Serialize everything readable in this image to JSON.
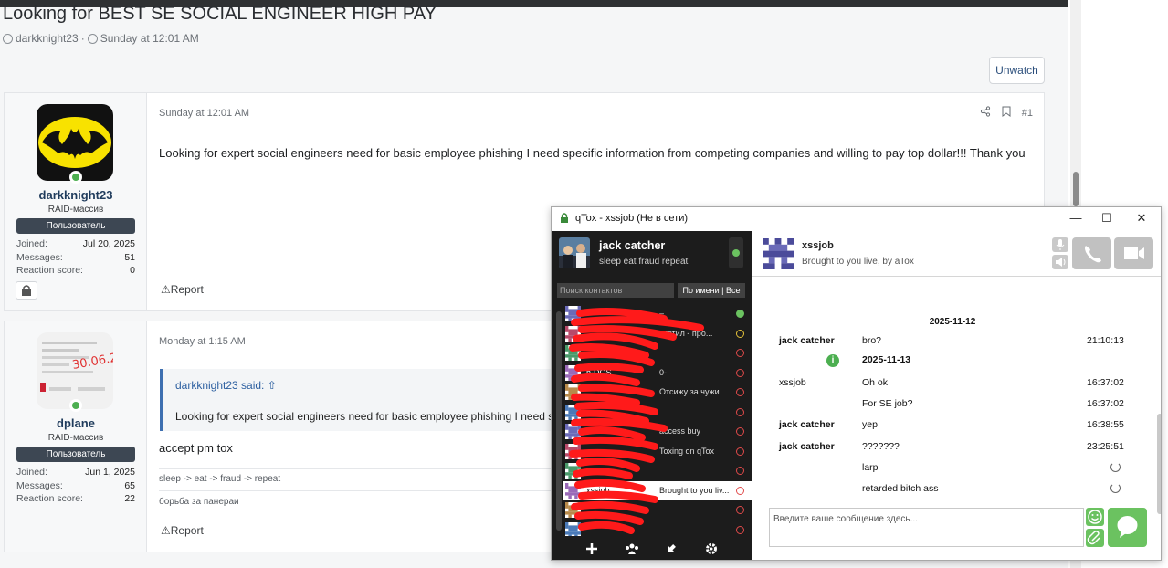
{
  "forum": {
    "thread_title": "Looking for BEST SE SOCIAL ENGINEER HIGH PAY",
    "thread_author": "darkknight23",
    "thread_date": "Sunday at 12:01 AM",
    "unwatch_label": "Unwatch",
    "posts": [
      {
        "username": "darkknight23",
        "user_title": "RAID-массив",
        "banner": "Пользователь",
        "stats": [
          {
            "label": "Joined:",
            "value": "Jul 20, 2025"
          },
          {
            "label": "Messages:",
            "value": "51"
          },
          {
            "label": "Reaction score:",
            "value": "0"
          }
        ],
        "date": "Sunday at 12:01 AM",
        "post_number": "#1",
        "body": "Looking for expert social engineers need for basic employee phishing I need specific information from competing companies and willing to pay top dollar!!! Thank you",
        "report_label": "Report"
      },
      {
        "username": "dplane",
        "user_title": "RAID-массив",
        "banner": "Пользователь",
        "stats": [
          {
            "label": "Joined:",
            "value": "Jun 1, 2025"
          },
          {
            "label": "Messages:",
            "value": "65"
          },
          {
            "label": "Reaction score:",
            "value": "22"
          }
        ],
        "date": "Monday at 1:15 AM",
        "quote_author": "darkknight23 said:",
        "quote_text": "Looking for expert social engineers need for basic employee phishing I need specific information from competing companies",
        "body": "accept pm tox",
        "signature": "sleep -> eat -> fraud -> repeat",
        "signature2": "борьба за панераи",
        "report_label": "Report"
      }
    ]
  },
  "qtox": {
    "window_title": "qTox - xssjob (Не в сети)",
    "self_name": "jack catcher",
    "self_status": "sleep eat fraud repeat",
    "search_placeholder": "Поиск контактов",
    "sort_label": "По имени | Все",
    "friends": [
      {
        "name": "–",
        "msg": "–",
        "status": "online"
      },
      {
        "name": "",
        "msg": "отетил - про...",
        "status": "away"
      },
      {
        "name": "",
        "msg": "",
        "status": "offline"
      },
      {
        "name": "h-DOS",
        "msg": "0-",
        "status": "offline"
      },
      {
        "name": "",
        "msg": "Отсижу за чужи...",
        "status": "offline"
      },
      {
        "name": "",
        "msg": "",
        "status": "offline"
      },
      {
        "name": "",
        "msg": "access buy",
        "status": "offline"
      },
      {
        "name": "",
        "msg": "Toxing on qTox",
        "status": "offline"
      },
      {
        "name": "",
        "msg": "",
        "status": "offline"
      },
      {
        "name": "xssjob",
        "msg": "Brought to you liv...",
        "status": "offline",
        "active": true
      },
      {
        "name": "",
        "msg": "",
        "status": "offline"
      },
      {
        "name": "",
        "msg": "",
        "status": "offline"
      }
    ],
    "peer_name": "xssjob",
    "peer_status": "Brought to you live, by aTox",
    "messages": {
      "date1": "2025-11-12",
      "date2": "2025-11-13",
      "m1": {
        "author": "jack catcher",
        "text": "bro?",
        "time": "21:10:13"
      },
      "m2": {
        "author": "xssjob",
        "text": "Oh ok",
        "time": "16:37:02"
      },
      "m3": {
        "author": "",
        "text": "For SE job?",
        "time": "16:37:02"
      },
      "m4": {
        "author": "jack catcher",
        "text": "yep",
        "time": "16:38:55"
      },
      "m5": {
        "author": "jack catcher",
        "text": "???????",
        "time": "23:25:51"
      },
      "m6": {
        "author": "",
        "text": "larp",
        "time": ""
      },
      "m7": {
        "author": "",
        "text": "retarded bitch ass",
        "time": ""
      }
    },
    "input_placeholder": "Введите ваше сообщение здесь..."
  },
  "colors": {
    "qtox_green": "#6bc260",
    "redaction": "#ff1a1a",
    "forum_link": "#2c5fa0"
  }
}
